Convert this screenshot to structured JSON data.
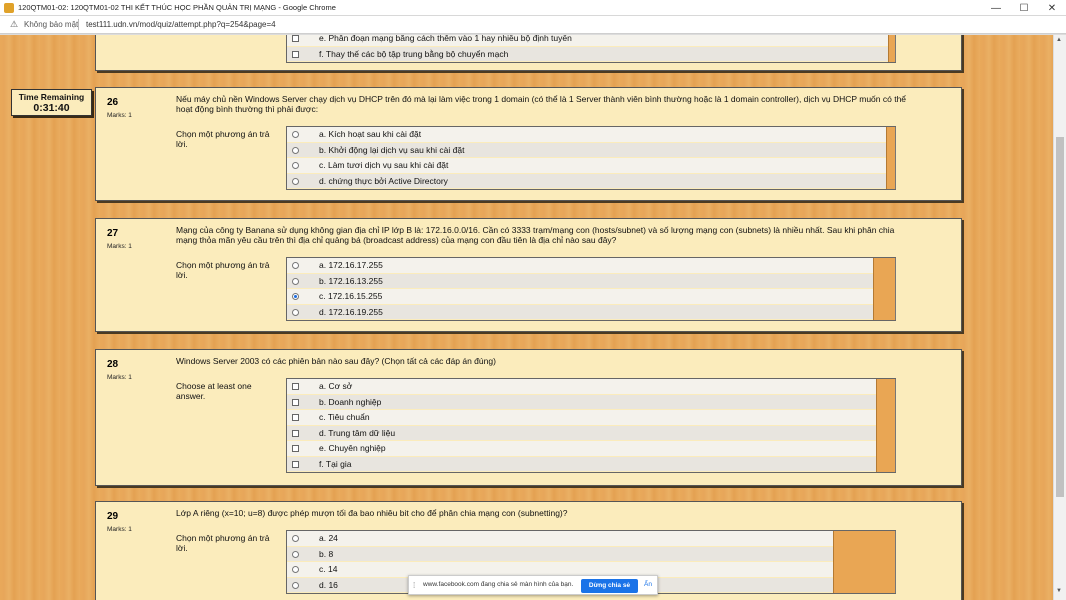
{
  "window": {
    "title": "120QTM01-02: 120QTM01-02 THI KẾT THÚC HỌC PHẦN QUẢN TRỊ MẠNG - Google Chrome",
    "minimize": "—",
    "maximize": "☐",
    "close": "✕"
  },
  "address": {
    "security": "Không bảo mật",
    "url": "test111.udn.vn/mod/quiz/attempt.php?q=254&page=4"
  },
  "timer": {
    "label": "Time Remaining",
    "value": "0:31:40"
  },
  "prev_question": {
    "answers": [
      "e. Phân đoạn mạng bằng cách thêm vào 1 hay nhiều bộ định tuyến",
      "f. Thay thế các bộ tập trung bằng bộ chuyển mạch"
    ]
  },
  "questions": [
    {
      "number": "26",
      "marks": "Marks: 1",
      "text": "Nếu máy chủ nền Windows Server chạy dịch vụ DHCP trên đó mà lại làm việc trong 1 domain (có thể là 1 Server thành viên bình thường hoặc là 1 domain controller), dịch vụ DHCP muốn có thể hoạt động bình thường thì phải được:",
      "prompt": "Chọn một phương án trả lời.",
      "answers": [
        "a. Kích hoạt sau khi cài đặt",
        "b. Khởi động lại dịch vụ sau khi cài đặt",
        "c. Làm tươi dịch vụ sau khi cài đặt",
        "d. chứng thực bởi Active Directory"
      ]
    },
    {
      "number": "27",
      "marks": "Marks: 1",
      "text": "Mạng của công ty Banana sử dụng không gian địa chỉ IP lớp B là: 172.16.0.0/16. Cần có 3333 trạm/mạng con (hosts/subnet) và số lượng mạng con (subnets) là nhiều nhất. Sau khi phân chia mạng thỏa mãn yêu cầu trên thì địa chỉ quảng bá (broadcast address) của mạng con đầu tiên là địa chỉ nào sau đây?",
      "prompt": "Chọn một phương án trả lời.",
      "answers": [
        "a. 172.16.17.255",
        "b. 172.16.13.255",
        "c. 172.16.15.255",
        "d. 172.16.19.255"
      ],
      "selected": "c. 172.16.15.255"
    },
    {
      "number": "28",
      "marks": "Marks: 1",
      "text": "Windows Server 2003 có các phiên bản nào sau đây? (Chọn tất cả các đáp án đúng)",
      "prompt": "Choose at least one answer.",
      "answers": [
        "a. Cơ sở",
        "b. Doanh nghiệp",
        "c. Tiêu chuẩn",
        "d. Trung tâm dữ liệu",
        "e. Chuyên nghiệp",
        "f. Tại gia"
      ]
    },
    {
      "number": "29",
      "marks": "Marks: 1",
      "text": "Lớp A riêng (x=10; u=8) được phép mượn tối đa bao nhiêu bit cho để phân chia mạng con (subnetting)?",
      "prompt": "Chọn một phương án trả lời.",
      "answers": [
        "a. 24",
        "b. 8",
        "c. 14",
        "d. 16"
      ]
    }
  ],
  "share_bar": {
    "message": "www.facebook.com đang chia sẻ màn hình của bạn.",
    "stop_label": "Dừng chia sẻ",
    "hide_label": "Ẩn"
  },
  "colors": {
    "background_wood": "#e9a95a",
    "question_panel": "#fbecbc",
    "share_button": "#1a73e8"
  }
}
